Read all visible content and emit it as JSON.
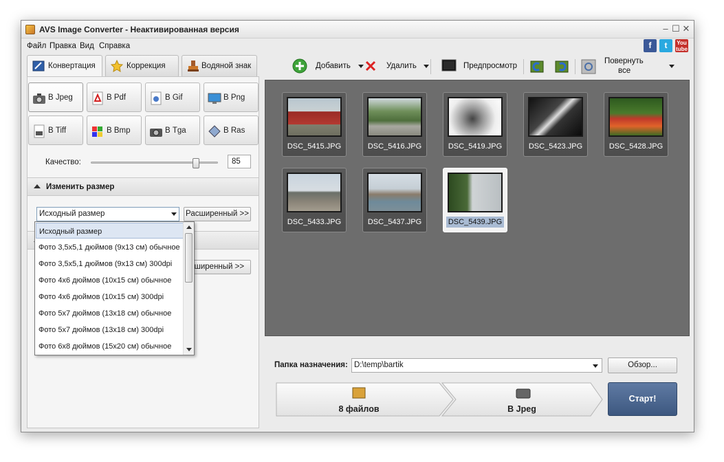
{
  "window": {
    "title": "AVS Image Converter - Неактивированная версия",
    "controls": [
      "–",
      "☐",
      "✕"
    ]
  },
  "menu": [
    "Файл",
    "Правка",
    "Вид",
    "Справка"
  ],
  "social": [
    {
      "icon": "facebook-icon",
      "text": "f",
      "color": "#3b5998"
    },
    {
      "icon": "twitter-icon",
      "text": "t",
      "color": "#2aa9e0"
    },
    {
      "icon": "youtube-icon",
      "text": "You",
      "color": "#c4302b"
    }
  ],
  "tabs": [
    {
      "label": "Конвертация",
      "active": true
    },
    {
      "label": "Коррекция",
      "active": false
    },
    {
      "label": "Водяной знак",
      "active": false
    }
  ],
  "formats": [
    {
      "label": "В Jpeg",
      "active": true
    },
    {
      "label": "В Pdf",
      "active": false
    },
    {
      "label": "В Gif",
      "active": false
    },
    {
      "label": "В Png",
      "active": false
    },
    {
      "label": "В Tiff",
      "active": false
    },
    {
      "label": "В Bmp",
      "active": false
    },
    {
      "label": "В Tga",
      "active": false
    },
    {
      "label": "В Ras",
      "active": false
    }
  ],
  "quality": {
    "label": "Качество:",
    "value": "85",
    "level": 0.85
  },
  "resize": {
    "header": "Изменить размер",
    "selected": "Исходный размер",
    "advanced_label": "Расширенный >>",
    "options": [
      "Исходный размер",
      "Фото 3,5x5,1 дюймов (9x13 см) обычное",
      "Фото 3,5x5,1 дюймов (9x13 см) 300dpi",
      "Фото 4x6 дюймов (10x15 см) обычное",
      "Фото 4x6 дюймов (10x15 см) 300dpi",
      "Фото 5x7 дюймов (13x18 см) обычное",
      "Фото 5x7 дюймов (13x18 см) 300dpi",
      "Фото 6x8 дюймов (15x20 см) обычное"
    ]
  },
  "second_section": {
    "advanced_label": "сширенный >>"
  },
  "toolbar": {
    "add": "Добавить",
    "delete": "Удалить",
    "preview": "Предпросмотр",
    "rotate_all_line1": "Повернуть",
    "rotate_all_line2": "все"
  },
  "files": [
    {
      "name": "DSC_5415.JPG",
      "selected": false
    },
    {
      "name": "DSC_5416.JPG",
      "selected": false
    },
    {
      "name": "DSC_5419.JPG",
      "selected": false
    },
    {
      "name": "DSC_5423.JPG",
      "selected": false
    },
    {
      "name": "DSC_5428.JPG",
      "selected": false
    },
    {
      "name": "DSC_5433.JPG",
      "selected": false
    },
    {
      "name": "DSC_5437.JPG",
      "selected": false
    },
    {
      "name": "DSC_5439.JPG",
      "selected": true
    }
  ],
  "destination": {
    "label": "Папка назначения:",
    "value": "D:\\temp\\bartik",
    "browse_label": "Обзор..."
  },
  "steps": {
    "files": "8 файлов",
    "format": "В Jpeg"
  },
  "start_label": "Старт!"
}
